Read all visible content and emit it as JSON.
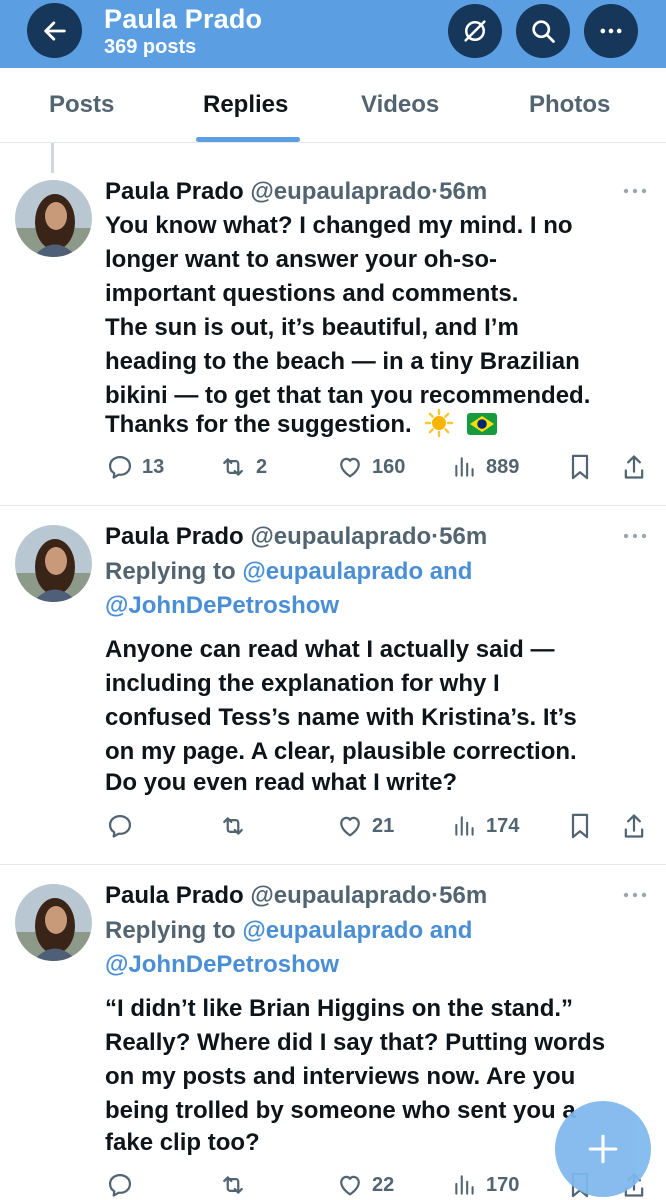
{
  "header": {
    "name": "Paula Prado",
    "post_count": "369 posts"
  },
  "tabs": [
    {
      "label": "Posts"
    },
    {
      "label": "Replies",
      "active": true
    },
    {
      "label": "Videos"
    },
    {
      "label": "Photos"
    }
  ],
  "tweets": [
    {
      "name": "Paula Prado",
      "handle": "@eupaulaprado",
      "sep": "·",
      "time": "56m",
      "lines": [
        "You know what? I changed my mind. I no",
        "longer want to answer your oh-so-",
        "important questions and comments.",
        "The sun is out, it’s beautiful, and I’m",
        "heading to the beach — in a tiny Brazilian",
        "bikini — to get that tan you recommended.",
        "Thanks for the suggestion."
      ],
      "emoji": "☀️",
      "replies": "13",
      "reposts": "2",
      "likes": "160",
      "views": "889"
    },
    {
      "name": "Paula Prado",
      "handle": "@eupaulaprado",
      "sep": "·",
      "time": "56m",
      "replying_prefix": "Replying to",
      "replying_to_1": "@eupaulaprado and",
      "replying_to_2": "@JohnDePetroshow",
      "lines": [
        "Anyone can read what I actually said —",
        "including the explanation for why I",
        "confused Tess’s name with Kristina’s. It’s",
        "on my page. A clear, plausible correction.",
        "Do you even read what I write?"
      ],
      "likes": "21",
      "views": "174"
    },
    {
      "name": "Paula Prado",
      "handle": "@eupaulaprado",
      "sep": "·",
      "time": "56m",
      "replying_prefix": "Replying to",
      "replying_to_1": "@eupaulaprado and",
      "replying_to_2": "@JohnDePetroshow",
      "lines": [
        "“I didn’t like Brian Higgins on the stand.”",
        "Really? Where did I say that? Putting words",
        "on my posts and interviews now. Are you",
        "being trolled by someone who sent you a",
        "fake clip too?"
      ],
      "likes": "22",
      "views": "170"
    }
  ],
  "colors": {
    "header_bg": "#5b9fe2",
    "header_button": "#16365a",
    "link": "#4a8fd6",
    "muted": "#536471",
    "fab": "#7fb8ee"
  },
  "icons": [
    "back-arrow-icon",
    "mute-icon",
    "search-icon",
    "more-icon",
    "reply-icon",
    "repost-icon",
    "like-icon",
    "views-icon",
    "bookmark-icon",
    "share-icon",
    "plus-icon"
  ]
}
